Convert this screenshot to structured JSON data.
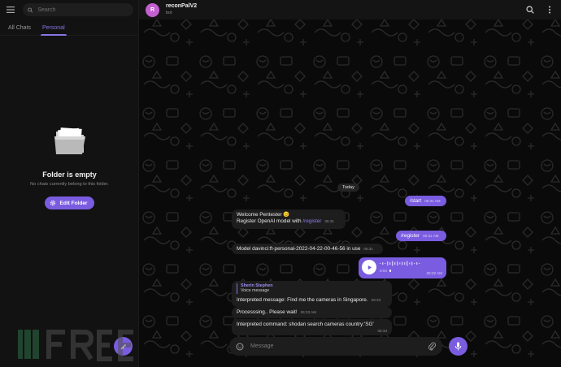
{
  "sidebar": {
    "search_placeholder": "Search",
    "tabs": [
      {
        "label": "All Chats",
        "active": false
      },
      {
        "label": "Personal",
        "active": true
      }
    ],
    "empty_title": "Folder is empty",
    "empty_subtitle": "No chats currently belong to this folder.",
    "edit_folder_label": "Edit Folder"
  },
  "header": {
    "avatar_letter": "R",
    "avatar_color": "#c35fcf",
    "name": "reconPalV2",
    "status": "bot"
  },
  "chat": {
    "date_label": "Today",
    "messages": [
      {
        "from": "out",
        "text": "/start",
        "time": "06:31 AM"
      },
      {
        "from": "in",
        "line1": "Welcome Pentester 😊",
        "line2": "Register OpenAI model with ",
        "link": "/register",
        "time": "06:31"
      },
      {
        "from": "out",
        "text": "/register",
        "time": "06:31 AM"
      },
      {
        "from": "in",
        "text": "Model davinci:ft-personal-2022-04-22-00-46-56 in use",
        "time": "06:31"
      },
      {
        "from": "out",
        "type": "voice",
        "duration": "0:04",
        "time": "06:32 AM"
      },
      {
        "from": "in",
        "reply_name": "Sherin Stephen",
        "reply_text": "Voice message",
        "text": "Interpreted message: Find me the cameras in Singapore.",
        "time": "06:33"
      },
      {
        "from": "in",
        "text": "Processsing.. Please wait!",
        "time": "06:33 AM"
      },
      {
        "from": "in",
        "text": "Interpreted command: shodan search cameras country:'SG'",
        "time": "06:33"
      }
    ]
  },
  "composer": {
    "placeholder": "Message"
  },
  "colors": {
    "accent": "#7a5ce0",
    "accent_text": "#8774e1",
    "background": "#0a0a0a"
  }
}
